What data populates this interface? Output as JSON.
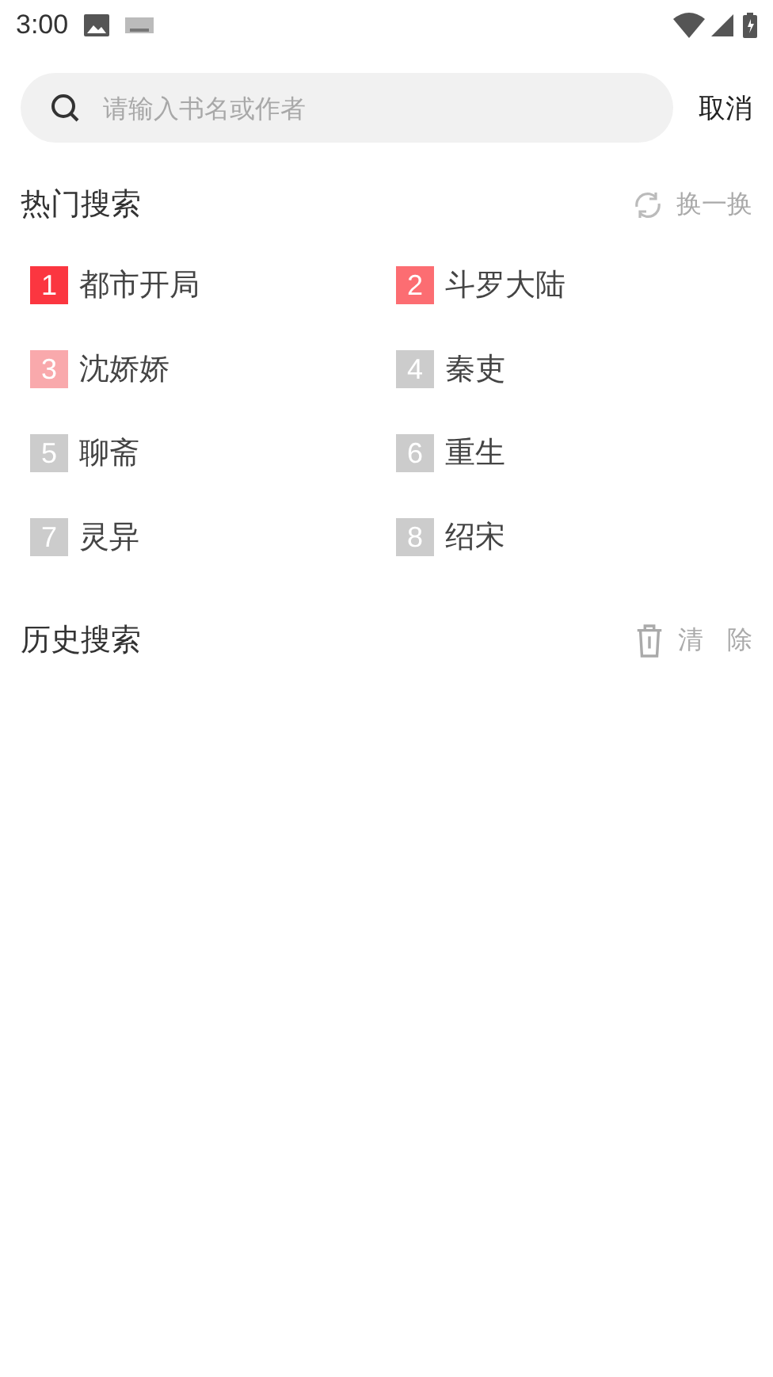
{
  "status_bar": {
    "time": "3:00"
  },
  "search": {
    "placeholder": "请输入书名或作者",
    "cancel": "取消"
  },
  "hot": {
    "title": "热门搜索",
    "refresh": "换一换",
    "items": [
      {
        "rank": "1",
        "title": "都市开局",
        "color": "#fb3640"
      },
      {
        "rank": "2",
        "title": "斗罗大陆",
        "color": "#fc6d72"
      },
      {
        "rank": "3",
        "title": "沈娇娇",
        "color": "#f9a9ac"
      },
      {
        "rank": "4",
        "title": "秦吏",
        "color": "#cccccc"
      },
      {
        "rank": "5",
        "title": "聊斋",
        "color": "#cccccc"
      },
      {
        "rank": "6",
        "title": "重生",
        "color": "#cccccc"
      },
      {
        "rank": "7",
        "title": "灵异",
        "color": "#cccccc"
      },
      {
        "rank": "8",
        "title": "绍宋",
        "color": "#cccccc"
      }
    ]
  },
  "history": {
    "title": "历史搜索",
    "clear": "清 除"
  }
}
